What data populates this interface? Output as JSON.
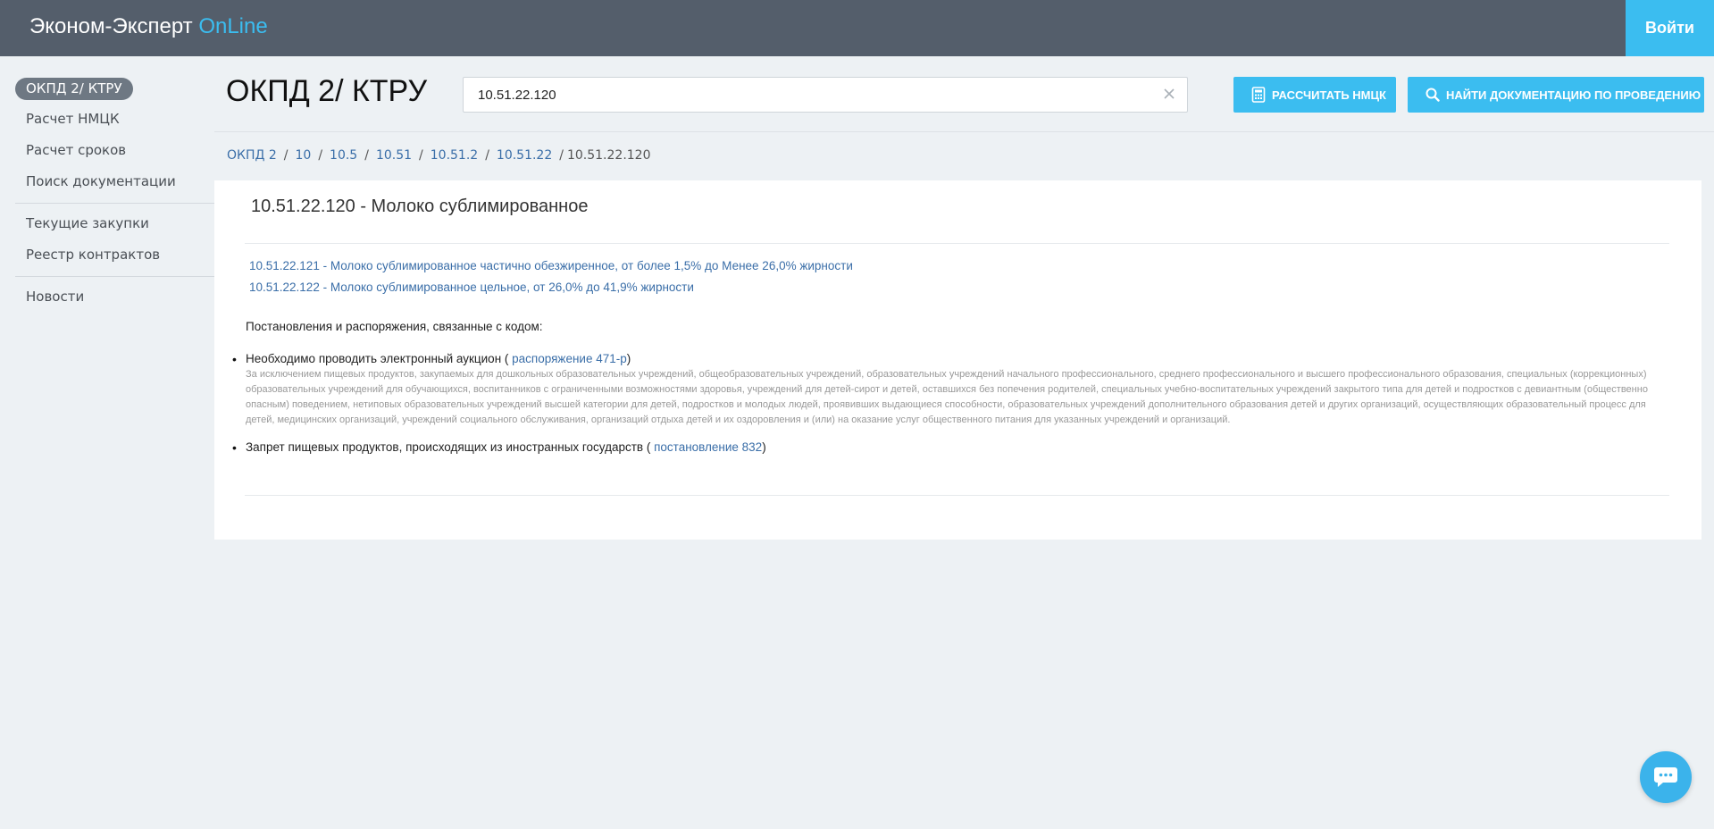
{
  "header": {
    "brand_main": "Эконом-Эксперт ",
    "brand_accent": "OnLine",
    "login_label": "Войти",
    "accent_color": "#3bbdf0",
    "bar_color": "#545e6b"
  },
  "sidebar": {
    "active_label": "ОКПД 2/ КТРУ",
    "items": [
      {
        "label": "Расчет НМЦК"
      },
      {
        "label": "Расчет сроков"
      },
      {
        "label": "Поиск документации"
      },
      {
        "label": "Текущие закупки"
      },
      {
        "label": "Реестр контрактов"
      },
      {
        "label": "Новости"
      }
    ]
  },
  "page": {
    "title": "ОКПД 2/ КТРУ"
  },
  "search": {
    "value": "10.51.22.120",
    "clear_icon": "close-icon"
  },
  "toolbar": {
    "calc_label": "РАССЧИТАТЬ НМЦК",
    "calc_icon": "calculator-icon",
    "docs_label": "НАЙТИ ДОКУМЕНТАЦИЮ ПО ПРОВЕДЕНИЮ",
    "docs_icon": "search-icon"
  },
  "breadcrumb": {
    "items": [
      "ОКПД 2",
      "10",
      "10.5",
      "10.51",
      "10.51.2",
      "10.51.22"
    ],
    "separator": "/",
    "current": "10.51.22.120"
  },
  "content": {
    "title": "10.51.22.120 - Молоко сублимированное",
    "subcodes": [
      "10.51.22.121 - Молоко сублимированное частично обезжиренное, от более 1,5% до Менее 26,0% жирности",
      "10.51.22.122 - Молоко сублимированное цельное, от 26,0% до 41,9% жирности"
    ],
    "section_heading": "Постановления и распоряжения, связанные с кодом:",
    "rules": [
      {
        "text_before": "Необходимо проводить электронный аукцион ( ",
        "link": "распоряжение 471-р",
        "text_after": ")",
        "note": "За исключением пищевых продуктов, закупаемых для дошкольных образовательных учреждений, общеобразовательных учреждений, образовательных учреждений начального профессионального, среднего профессионального и высшего профессионального образования, специальных (коррекционных) образовательных учреждений для обучающихся, воспитанников с ограниченными возможностями здоровья, учреждений для детей-сирот и детей, оставшихся без попечения родителей, специальных учебно-воспитательных учреждений закрытого типа для детей и подростков с девиантным (общественно опасным) поведением, нетиповых образовательных учреждений высшей категории для детей, подростков и молодых людей, проявивших выдающиеся способности, образовательных учреждений дополнительного образования детей и других организаций, осуществляющих образовательный процесс для детей, медицинских организаций, учреждений социального обслуживания, организаций отдыха детей и их оздоровления и (или) на оказание услуг общественного питания для указанных учреждений и организаций."
      },
      {
        "text_before": "Запрет пищевых продуктов, происходящих из иностранных государств ( ",
        "link": "постановление 832",
        "text_after": ")"
      }
    ]
  },
  "chat": {
    "icon": "chat-icon"
  }
}
